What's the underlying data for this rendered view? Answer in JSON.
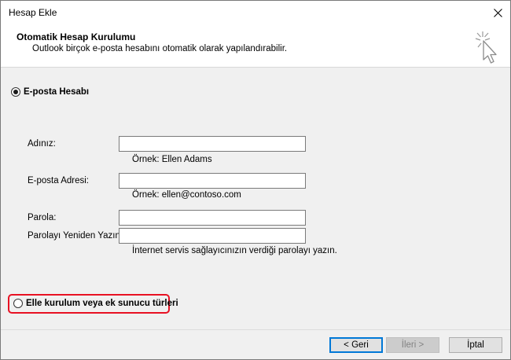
{
  "window": {
    "title": "Hesap Ekle"
  },
  "header": {
    "title": "Otomatik Hesap Kurulumu",
    "subtitle": "Outlook birçok e-posta hesabını otomatik olarak yapılandırabilir."
  },
  "options": {
    "email_account": {
      "label": "E-posta Hesabı",
      "selected": true
    },
    "manual_setup": {
      "label": "Elle kurulum veya ek sunucu türleri",
      "selected": false
    }
  },
  "form": {
    "name": {
      "label": "Adınız:",
      "value": "",
      "hint": "Örnek: Ellen Adams"
    },
    "email": {
      "label": "E-posta Adresi:",
      "value": "",
      "hint": "Örnek: ellen@contoso.com"
    },
    "password": {
      "label": "Parola:",
      "value": ""
    },
    "password_confirm": {
      "label": "Parolayı Yeniden Yazın:",
      "value": ""
    },
    "password_hint": "İnternet servis sağlayıcınızın verdiği parolayı yazın."
  },
  "buttons": {
    "back": "< Geri",
    "next": "İleri >",
    "cancel": "İptal"
  },
  "colors": {
    "highlight": "#e81123",
    "default_button_border": "#0078d7"
  }
}
